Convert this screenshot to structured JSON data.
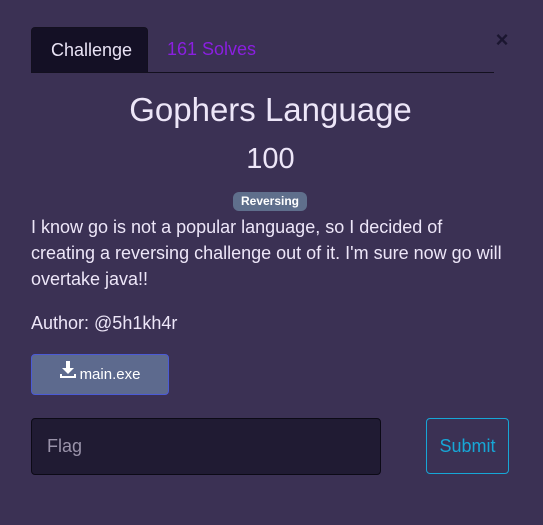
{
  "modal": {
    "close_label": "×"
  },
  "tabs": [
    {
      "label": "Challenge",
      "active": true
    },
    {
      "label": "161 Solves",
      "active": false
    }
  ],
  "challenge": {
    "title": "Gophers Language",
    "points": "100",
    "category": "Reversing",
    "description": "I know go is not a popular language, so I decided of creating a reversing challenge out of it. I'm sure now go will overtake java!!",
    "author": "Author: @5h1kh4r",
    "file": {
      "label": "main.exe",
      "icon": "download-icon"
    }
  },
  "form": {
    "flag_placeholder": "Flag",
    "flag_value": "",
    "submit_label": "Submit"
  },
  "colors": {
    "background": "#3b3154",
    "tab_active_bg": "#141025",
    "tab_inactive_text": "#8a1fe0",
    "tag_bg": "#5f6f8c",
    "file_button_bg": "#5d6a8e",
    "submit_accent": "#17a6d6"
  }
}
